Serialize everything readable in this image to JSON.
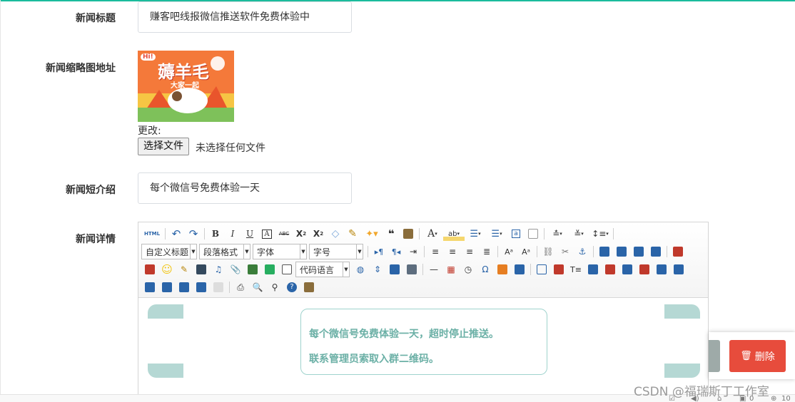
{
  "form": {
    "title_label": "新闻标题",
    "title_value": "赚客吧线报微信推送软件免费体验中",
    "thumb_label": "新闻缩略图地址",
    "thumb_text": "薅羊毛",
    "thumb_subtext": "大家一起",
    "thumb_badge": "Hi!",
    "change_label": "更改:",
    "file_button": "选择文件",
    "file_status": "未选择任何文件",
    "intro_label": "新闻短介绍",
    "intro_value": "每个微信号免费体验一天",
    "detail_label": "新闻详情"
  },
  "editor": {
    "html_btn": "HTML",
    "bold": "B",
    "italic": "I",
    "underline": "U",
    "strike": "ABC",
    "select_custom_title": "自定义标题",
    "select_paragraph": "段落格式",
    "select_font": "字体",
    "select_size": "字号",
    "select_code_lang": "代码语言",
    "content_line1": "每个微信号免费体验一天，超时停止推送。",
    "content_line2": "联系管理员索取入群二维码。"
  },
  "actions": {
    "delete_label": "删除"
  },
  "watermark": "CSDN @福瑞斯丁工作室",
  "statusbar": {
    "count_a": "0",
    "zoom": "10"
  },
  "colors": {
    "accent_top": "#1abc9c",
    "delete": "#e74c3c",
    "content_text": "#6bb0a6",
    "blob": "#b5d8d4"
  }
}
